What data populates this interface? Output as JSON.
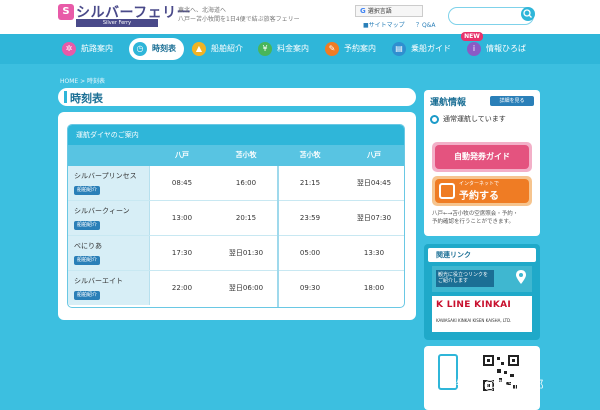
{
  "header": {
    "logo_mark": "S",
    "logo_text": "シルバーフェリー",
    "logo_sub": "Silver Ferry",
    "tagline_1": "東北へ、北海道へ",
    "tagline_2": "八戸ー苫小牧間を1日4便で結ぶ旅客フェリー",
    "translate_g": "G",
    "translate_label": "選択言語",
    "sitemap_label": "■サイトマップ",
    "qa_label": "？Q&A",
    "search_placeholder": ""
  },
  "nav": {
    "items": [
      {
        "label": "航路案内",
        "color": "#e85aa8"
      },
      {
        "label": "時刻表",
        "color": "#2fb6d9"
      },
      {
        "label": "船舶紹介",
        "color": "#f0b323"
      },
      {
        "label": "料金案内",
        "color": "#49b65a"
      },
      {
        "label": "予約案内",
        "color": "#ef7c24"
      },
      {
        "label": "乗船ガイド",
        "color": "#2f8fd0"
      },
      {
        "label": "情報ひろば",
        "color": "#8a5bc6"
      }
    ],
    "new_badge": "NEW"
  },
  "main": {
    "breadcrumb": "HOME > 時刻表",
    "page_title": "時刻表",
    "table_title": "運航ダイヤのご案内",
    "columns": [
      "八戸",
      "苫小牧",
      "苫小牧",
      "八戸"
    ],
    "ship_button_label": "船舶紹介",
    "rows": [
      {
        "ship": "シルバープリンセス",
        "times": [
          "08:45",
          "16:00",
          "21:15",
          "翌日04:45"
        ]
      },
      {
        "ship": "シルバークィーン",
        "times": [
          "13:00",
          "20:15",
          "23:59",
          "翌日07:30"
        ]
      },
      {
        "ship": "べにりあ",
        "times": [
          "17:30",
          "翌日01:30",
          "05:00",
          "13:30"
        ]
      },
      {
        "ship": "シルバーエイト",
        "times": [
          "22:00",
          "翌日06:00",
          "09:30",
          "18:00"
        ]
      }
    ]
  },
  "sidebar": {
    "status_title": "運航情報",
    "detail_button": "詳細を見る",
    "status_text": "通常運航しています",
    "banner_ticket": "自動発券ガイド",
    "banner_reserve_small": "インターネットで",
    "banner_reserve_big": "予約する",
    "note_1": "八戸←→苫小牧の空席照会・予約・",
    "note_2": "予約確認を行うことができます。",
    "links_title": "関連リンク",
    "map_text": "観光に役立つリンクをご紹介します",
    "kline_logo": "K LINE KINKAI",
    "kline_sub": "KAWASAKI KINKAI KISEN KAISHA, LTD."
  },
  "watermark": "知乎 @鴨江一郎"
}
